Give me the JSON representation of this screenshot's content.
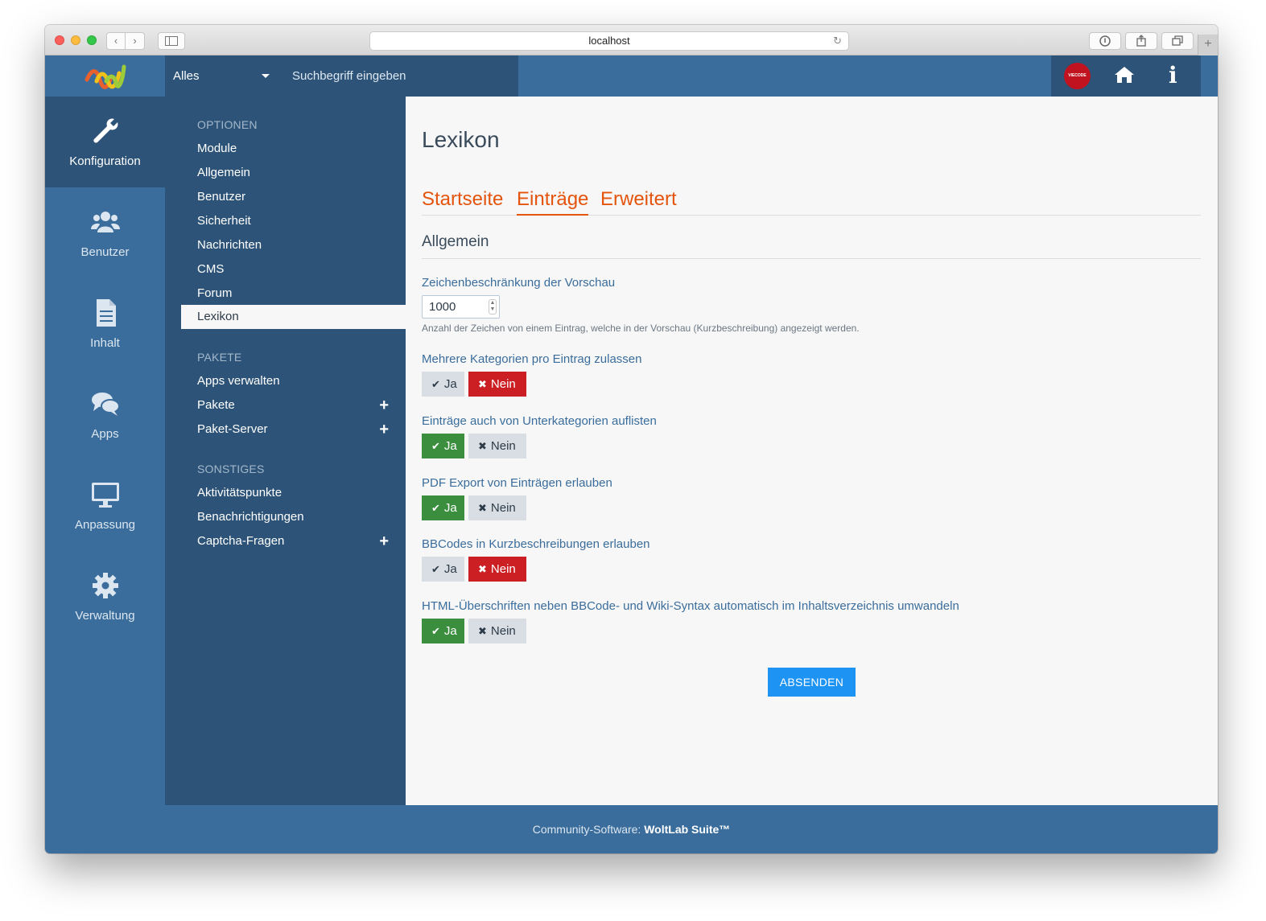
{
  "browser": {
    "url": "localhost"
  },
  "header": {
    "search_scope": "Alles",
    "search_placeholder": "Suchbegriff eingeben",
    "avatar_text": "VIECODE"
  },
  "mainmenu": {
    "items": [
      {
        "label": "Konfiguration",
        "icon": "wrench-icon",
        "active": true
      },
      {
        "label": "Benutzer",
        "icon": "users-icon",
        "active": false
      },
      {
        "label": "Inhalt",
        "icon": "document-icon",
        "active": false
      },
      {
        "label": "Apps",
        "icon": "comments-icon",
        "active": false
      },
      {
        "label": "Anpassung",
        "icon": "desktop-icon",
        "active": false
      },
      {
        "label": "Verwaltung",
        "icon": "gear-icon",
        "active": false
      }
    ]
  },
  "submenu": {
    "headings": {
      "optionen": "OPTIONEN",
      "pakete": "PAKETE",
      "sonstiges": "SONSTIGES"
    },
    "optionen": [
      "Module",
      "Allgemein",
      "Benutzer",
      "Sicherheit",
      "Nachrichten",
      "CMS",
      "Forum",
      "Lexikon"
    ],
    "pakete": [
      "Apps verwalten",
      "Pakete",
      "Paket-Server"
    ],
    "sonstiges": [
      "Aktivitätspunkte",
      "Benachrichtigungen",
      "Captcha-Fragen"
    ],
    "active": "Lexikon"
  },
  "content": {
    "title": "Lexikon",
    "tabs": [
      "Startseite",
      "Einträge",
      "Erweitert"
    ],
    "active_tab": "Einträge",
    "section": "Allgemein",
    "preview_limit": {
      "label": "Zeichenbeschränkung der Vorschau",
      "value": "1000",
      "description": "Anzahl der Zeichen von einem Eintrag, welche in der Vorschau (Kurzbeschreibung) angezeigt werden."
    },
    "yes_label": "Ja",
    "no_label": "Nein",
    "options": [
      {
        "label": "Mehrere Kategorien pro Eintrag zulassen",
        "value": "no"
      },
      {
        "label": "Einträge auch von Unterkategorien auflisten",
        "value": "yes"
      },
      {
        "label": "PDF Export von Einträgen erlauben",
        "value": "yes"
      },
      {
        "label": "BBCodes in Kurzbeschreibungen erlauben",
        "value": "no"
      },
      {
        "label": "HTML-Überschriften neben BBCode- und Wiki-Syntax automatisch im Inhaltsverzeichnis umwandeln",
        "value": "yes"
      }
    ],
    "submit": "ABSENDEN"
  },
  "footer": {
    "prefix": "Community-Software: ",
    "brand": "WoltLab Suite™"
  },
  "colors": {
    "header_blue": "#3a6d9c",
    "dark_blue": "#2d5478",
    "accent_orange": "#e4540d",
    "yes_green": "#3a8e3e",
    "no_red": "#cc1f24",
    "submit_blue": "#1d93f3"
  }
}
